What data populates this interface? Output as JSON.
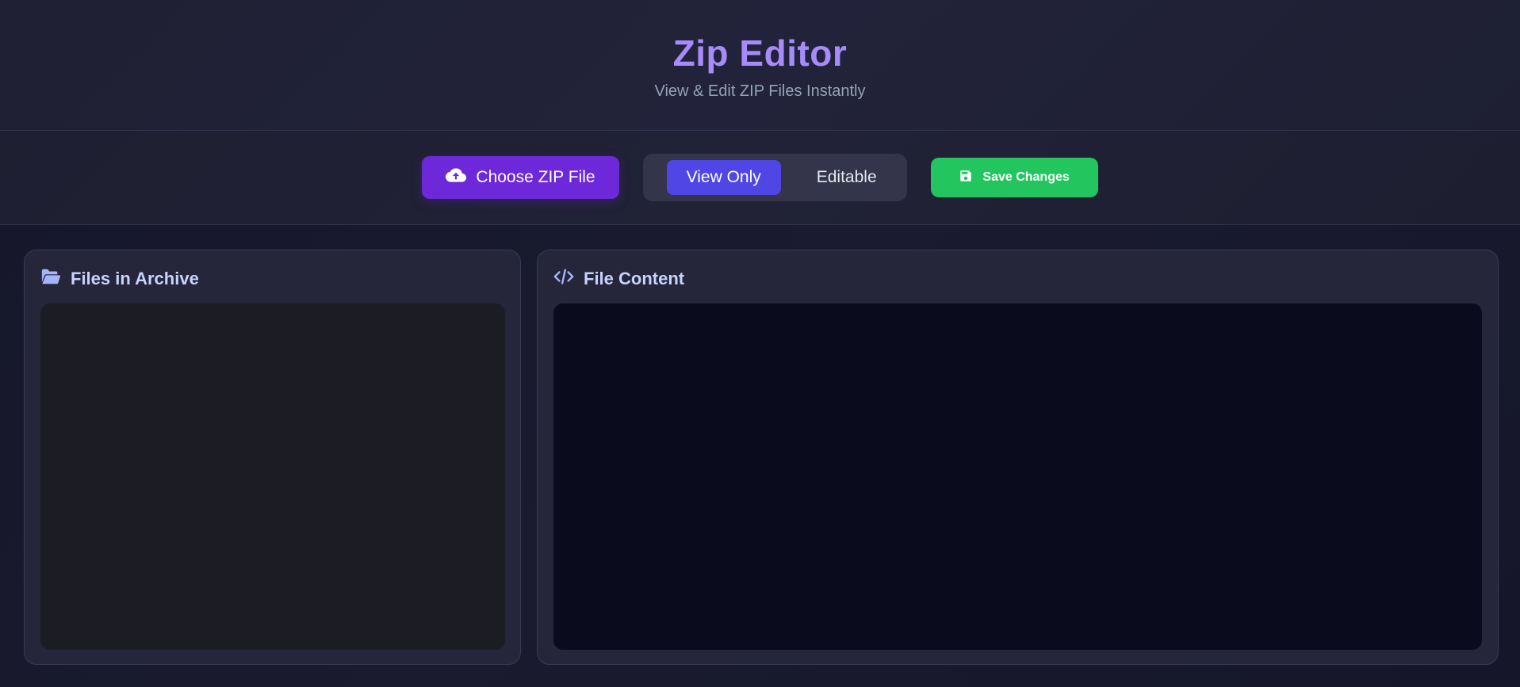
{
  "header": {
    "title": "Zip Editor",
    "subtitle": "View & Edit ZIP Files Instantly"
  },
  "toolbar": {
    "choose_label": "Choose ZIP File",
    "choose_icon": "cloud-upload-icon",
    "modes": [
      {
        "label": "View Only",
        "active": true
      },
      {
        "label": "Editable",
        "active": false
      }
    ],
    "save_label": "Save Changes",
    "save_icon": "floppy-disk-icon"
  },
  "panels": {
    "files": {
      "title": "Files in Archive",
      "icon": "folder-open-icon"
    },
    "content": {
      "title": "File Content",
      "icon": "code-icon"
    }
  },
  "colors": {
    "title": "#a78bfa",
    "choose_button": "#6d28d9",
    "active_mode": "#4f46e5",
    "save_button": "#22c55e"
  }
}
